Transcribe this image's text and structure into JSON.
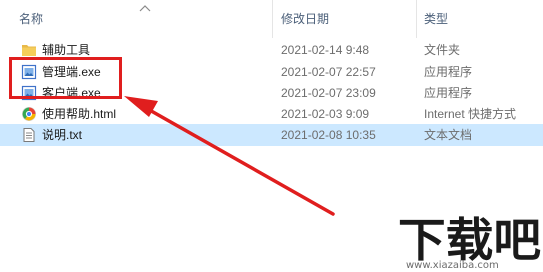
{
  "header": {
    "name": "名称",
    "date_modified": "修改日期",
    "type": "类型"
  },
  "files": [
    {
      "name": "辅助工具",
      "date": "2021-02-14 9:48",
      "type": "文件夹",
      "icon": "folder-icon",
      "selected": false
    },
    {
      "name": "管理端.exe",
      "date": "2021-02-07 22:57",
      "type": "应用程序",
      "icon": "exe-icon",
      "selected": false
    },
    {
      "name": "客户端.exe",
      "date": "2021-02-07 23:09",
      "type": "应用程序",
      "icon": "exe-icon",
      "selected": false
    },
    {
      "name": "使用帮助.html",
      "date": "2021-02-03 9:09",
      "type": "Internet 快捷方式",
      "icon": "html-shortcut-icon",
      "selected": false
    },
    {
      "name": "说明.txt",
      "date": "2021-02-08 10:35",
      "type": "文本文档",
      "icon": "txt-file-icon",
      "selected": true
    }
  ],
  "annotation": {
    "highlight_color": "#e01e1e"
  },
  "watermark": {
    "logo_text": "下载吧",
    "url": "www.xiazaiba.com"
  },
  "colors": {
    "selected_row": "#cce8ff",
    "header_text": "#4c607a",
    "detail_text": "#6d6d6d"
  }
}
